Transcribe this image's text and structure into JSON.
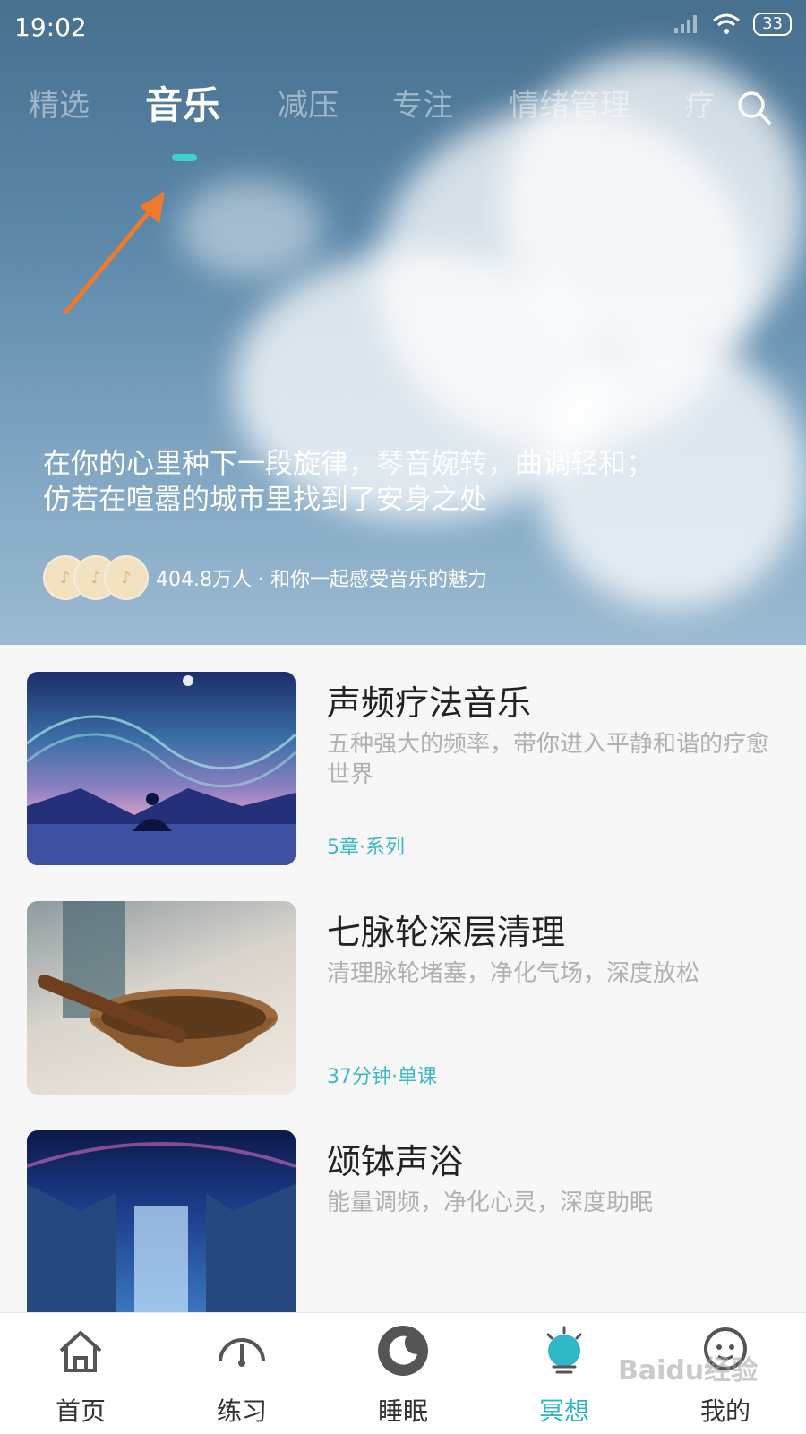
{
  "status_bar": {
    "time": "19:02",
    "battery": "33"
  },
  "tabs": [
    {
      "label": "精选"
    },
    {
      "label": "音乐"
    },
    {
      "label": "减压"
    },
    {
      "label": "专注"
    },
    {
      "label": "情绪管理"
    },
    {
      "label": "疗"
    }
  ],
  "active_tab": "音乐",
  "hero": {
    "line1": "在你的心里种下一段旋律，琴音婉转，曲调轻和；",
    "line2": "仿若在喧嚣的城市里找到了安身之处",
    "social_text": "404.8万人 · 和你一起感受音乐的魅力"
  },
  "items": [
    {
      "title": "声频疗法音乐",
      "desc": "五种强大的频率，带你进入平静和谐的疗愈世界",
      "meta": "5章·系列"
    },
    {
      "title": "七脉轮深层清理",
      "desc": "清理脉轮堵塞，净化气场，深度放松",
      "meta": "37分钟·单课"
    },
    {
      "title": "颂钵声浴",
      "desc": "能量调频，净化心灵，深度助眠",
      "meta": ""
    }
  ],
  "bottom_nav": [
    {
      "label": "首页",
      "icon": "home-icon"
    },
    {
      "label": "练习",
      "icon": "gauge-icon"
    },
    {
      "label": "睡眠",
      "icon": "moon-icon"
    },
    {
      "label": "冥想",
      "icon": "meditation-icon"
    },
    {
      "label": "我的",
      "icon": "profile-icon"
    }
  ],
  "watermark": "Baidu经验",
  "colors": {
    "accent": "#3fd0d0",
    "meta": "#3ab9c4",
    "nav_active": "#2fb7c6",
    "arrow": "#f07a2c"
  }
}
